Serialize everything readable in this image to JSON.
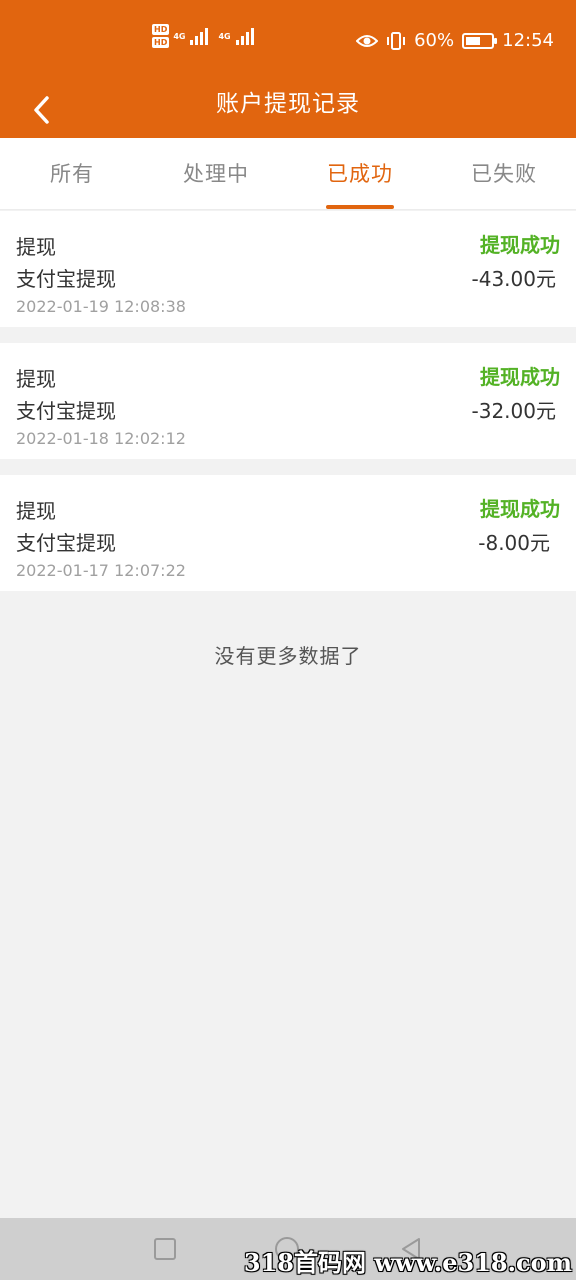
{
  "status_bar": {
    "hd_label": "HD",
    "network_label": "4G",
    "battery_percent": "60%",
    "battery_level": 0.6,
    "time": "12:54"
  },
  "header": {
    "title": "账户提现记录",
    "back_icon": "chevron-left-icon"
  },
  "tabs": [
    {
      "label": "所有",
      "active": false
    },
    {
      "label": "处理中",
      "active": false
    },
    {
      "label": "已成功",
      "active": true
    },
    {
      "label": "已失败",
      "active": false
    }
  ],
  "records": [
    {
      "type": "提现",
      "method": "支付宝提现",
      "time": "2022-01-19 12:08:38",
      "status": "提现成功",
      "amount": "-43.00元"
    },
    {
      "type": "提现",
      "method": "支付宝提现",
      "time": "2022-01-18 12:02:12",
      "status": "提现成功",
      "amount": "-32.00元"
    },
    {
      "type": "提现",
      "method": "支付宝提现",
      "time": "2022-01-17 12:07:22",
      "status": "提现成功",
      "amount": "-8.00元"
    }
  ],
  "footer_text": "没有更多数据了",
  "nav": [
    "square-icon",
    "circle-icon",
    "triangle-back-icon"
  ],
  "watermark": "318首码网 www.e318.com",
  "colors": {
    "accent": "#e1650f",
    "success": "#53b225"
  }
}
